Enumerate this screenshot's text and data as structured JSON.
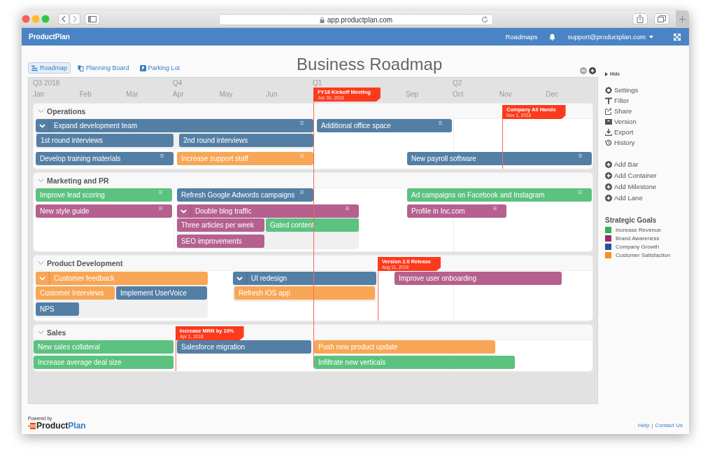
{
  "browser": {
    "url": "app.productplan.com"
  },
  "navbar": {
    "brand": "ProductPlan",
    "links": [
      {
        "label": "Roadmaps"
      }
    ],
    "account": "support@productplan.com"
  },
  "view_tabs": [
    {
      "label": "Roadmap",
      "selected": true
    },
    {
      "label": "Planning Board",
      "selected": false
    },
    {
      "label": "Parking Lot",
      "selected": false
    }
  ],
  "title": "Business Roadmap",
  "timeline": {
    "quarters": [
      {
        "label": "Q3 2018"
      },
      {
        "label": "Q4"
      },
      {
        "label": "Q1"
      },
      {
        "label": "Q2"
      }
    ],
    "months": [
      {
        "label": "Jan"
      },
      {
        "label": "Feb"
      },
      {
        "label": "Mar"
      },
      {
        "label": "Apr"
      },
      {
        "label": "May"
      },
      {
        "label": "Jun"
      },
      {
        "label": "Sep"
      },
      {
        "label": "Oct"
      },
      {
        "label": "Nov"
      },
      {
        "label": "Dec"
      }
    ],
    "milestones": [
      {
        "title": "FY18 Kickoff Meeting",
        "date": "Jun 30, 2018"
      }
    ]
  },
  "lanes": [
    {
      "title": "Operations",
      "expanded": true,
      "milestones": [
        {
          "title": "Company All Hands",
          "date": "Nov 1, 2018"
        }
      ],
      "bars": [
        {
          "kind": "container",
          "label": "Expand development team",
          "color": "#547fa5",
          "grip": true,
          "expanded": true,
          "children": [
            {
              "label": "1st round interviews",
              "color": "#547fa5"
            },
            {
              "label": "2nd round interviews",
              "color": "#547fa5"
            }
          ]
        },
        {
          "kind": "bar",
          "label": "Additional office space",
          "color": "#547fa5",
          "grip": true
        },
        {
          "kind": "bar",
          "label": "Develop training materials",
          "color": "#547fa5",
          "grip": true
        },
        {
          "kind": "bar",
          "label": "Increase support staff",
          "color": "#f8a655",
          "grip": true
        },
        {
          "kind": "bar",
          "label": "New payroll software",
          "color": "#547fa5",
          "grip": true
        }
      ]
    },
    {
      "title": "Marketing and PR",
      "expanded": true,
      "bars": [
        {
          "kind": "bar",
          "label": "Improve lead scoring",
          "color": "#5bc27f",
          "grip": true
        },
        {
          "kind": "bar",
          "label": "Refresh Google Adwords campaigns",
          "color": "#547fa5",
          "grip": true
        },
        {
          "kind": "bar",
          "label": "Ad campaigns on Facebook and Instagram",
          "color": "#5bc27f",
          "grip": true
        },
        {
          "kind": "bar",
          "label": "New style guide",
          "color": "#b5608f",
          "grip": true
        },
        {
          "kind": "container",
          "label": "Double blog traffic",
          "color": "#b5608f",
          "grip": true,
          "expanded": true,
          "children": [
            {
              "label": "Three articles per week",
              "color": "#b5608f"
            },
            {
              "label": "Gated content",
              "color": "#5bc27f"
            },
            {
              "label": "SEO improvements",
              "color": "#b5608f"
            }
          ]
        },
        {
          "kind": "bar",
          "label": "Profile in Inc.com",
          "color": "#b5608f",
          "grip": true
        }
      ]
    },
    {
      "title": "Product Development",
      "expanded": true,
      "milestones": [
        {
          "title": "Version 2.0 Release",
          "date": "Aug 11, 2018"
        }
      ],
      "bars": [
        {
          "kind": "container",
          "label": "Customer feedback",
          "color": "#f8a655",
          "grip": false,
          "expanded": true,
          "children": [
            {
              "label": "Customer Interviews",
              "color": "#f8a655"
            },
            {
              "label": "Implement UserVoice",
              "color": "#547fa5"
            },
            {
              "label": "NPS",
              "color": "#547fa5"
            }
          ]
        },
        {
          "kind": "container",
          "label": "UI redesign",
          "color": "#547fa5",
          "grip": false,
          "expanded": true,
          "children": [
            {
              "label": "Refresh iOS app",
              "color": "#f8a655"
            }
          ]
        },
        {
          "kind": "bar",
          "label": "Improve user onboarding",
          "color": "#b5608f",
          "grip": false
        }
      ]
    },
    {
      "title": "Sales",
      "expanded": true,
      "milestones": [
        {
          "title": "Increase MRR by 10%",
          "date": "Apr 1, 2018"
        }
      ],
      "bars": [
        {
          "kind": "bar",
          "label": "New sales collateral",
          "color": "#5bc27f",
          "grip": false
        },
        {
          "kind": "bar",
          "label": "Salesforce migration",
          "color": "#547fa5",
          "grip": false
        },
        {
          "kind": "bar",
          "label": "Push new product update",
          "color": "#f8a655",
          "grip": false
        },
        {
          "kind": "bar",
          "label": "Increase average deal size",
          "color": "#5bc27f",
          "grip": false
        },
        {
          "kind": "bar",
          "label": "Infiltrate new verticals",
          "color": "#5bc27f",
          "grip": false
        }
      ]
    }
  ],
  "sidebar": {
    "hide": "Hide",
    "actions": [
      {
        "label": "Settings"
      },
      {
        "label": "Filter"
      },
      {
        "label": "Share"
      },
      {
        "label": "Version"
      },
      {
        "label": "Export"
      },
      {
        "label": "History"
      }
    ],
    "add_actions": [
      {
        "label": "Add Bar"
      },
      {
        "label": "Add Container"
      },
      {
        "label": "Add Milestone"
      },
      {
        "label": "Add Lane"
      }
    ],
    "goals_title": "Strategic Goals",
    "goals": [
      {
        "label": "Increase Revenue",
        "color": "#2db453"
      },
      {
        "label": "Brand Awareness",
        "color": "#9c2b6d"
      },
      {
        "label": "Company Growth",
        "color": "#1e5793"
      },
      {
        "label": "Customer Satisfaction",
        "color": "#ff8c1a"
      }
    ]
  },
  "footer": {
    "powered_by": "Powered by",
    "logo": [
      "Product",
      "Plan"
    ],
    "links": [
      {
        "label": "Help"
      },
      {
        "label": "Contact Us"
      }
    ],
    "separator": "|"
  }
}
